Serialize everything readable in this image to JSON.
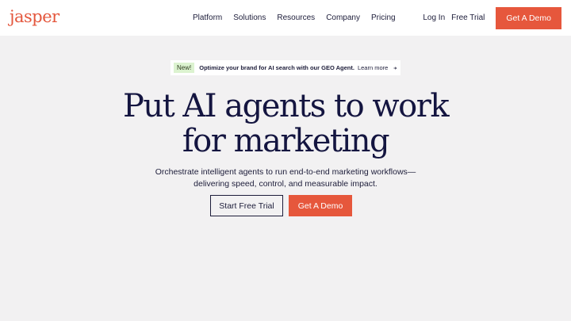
{
  "brand": {
    "logo_text": "jasper",
    "accent": "#e6573c"
  },
  "nav": {
    "items": [
      {
        "label": "Platform"
      },
      {
        "label": "Solutions"
      },
      {
        "label": "Resources"
      },
      {
        "label": "Company"
      },
      {
        "label": "Pricing"
      }
    ],
    "login": "Log In",
    "free_trial": "Free Trial",
    "demo": "Get A Demo"
  },
  "banner": {
    "badge": "New!",
    "text": "Optimize your brand for AI search with our GEO Agent.",
    "link": "Learn more",
    "icon": "arrow-right-icon"
  },
  "hero": {
    "title_line1": "Put AI agents to work",
    "title_line2": "for marketing",
    "subtitle_line1": "Orchestrate intelligent agents to run end-to-end marketing workflows—",
    "subtitle_line2": "delivering speed, control, and measurable impact.",
    "cta_trial": "Start Free Trial",
    "cta_demo": "Get A Demo"
  }
}
